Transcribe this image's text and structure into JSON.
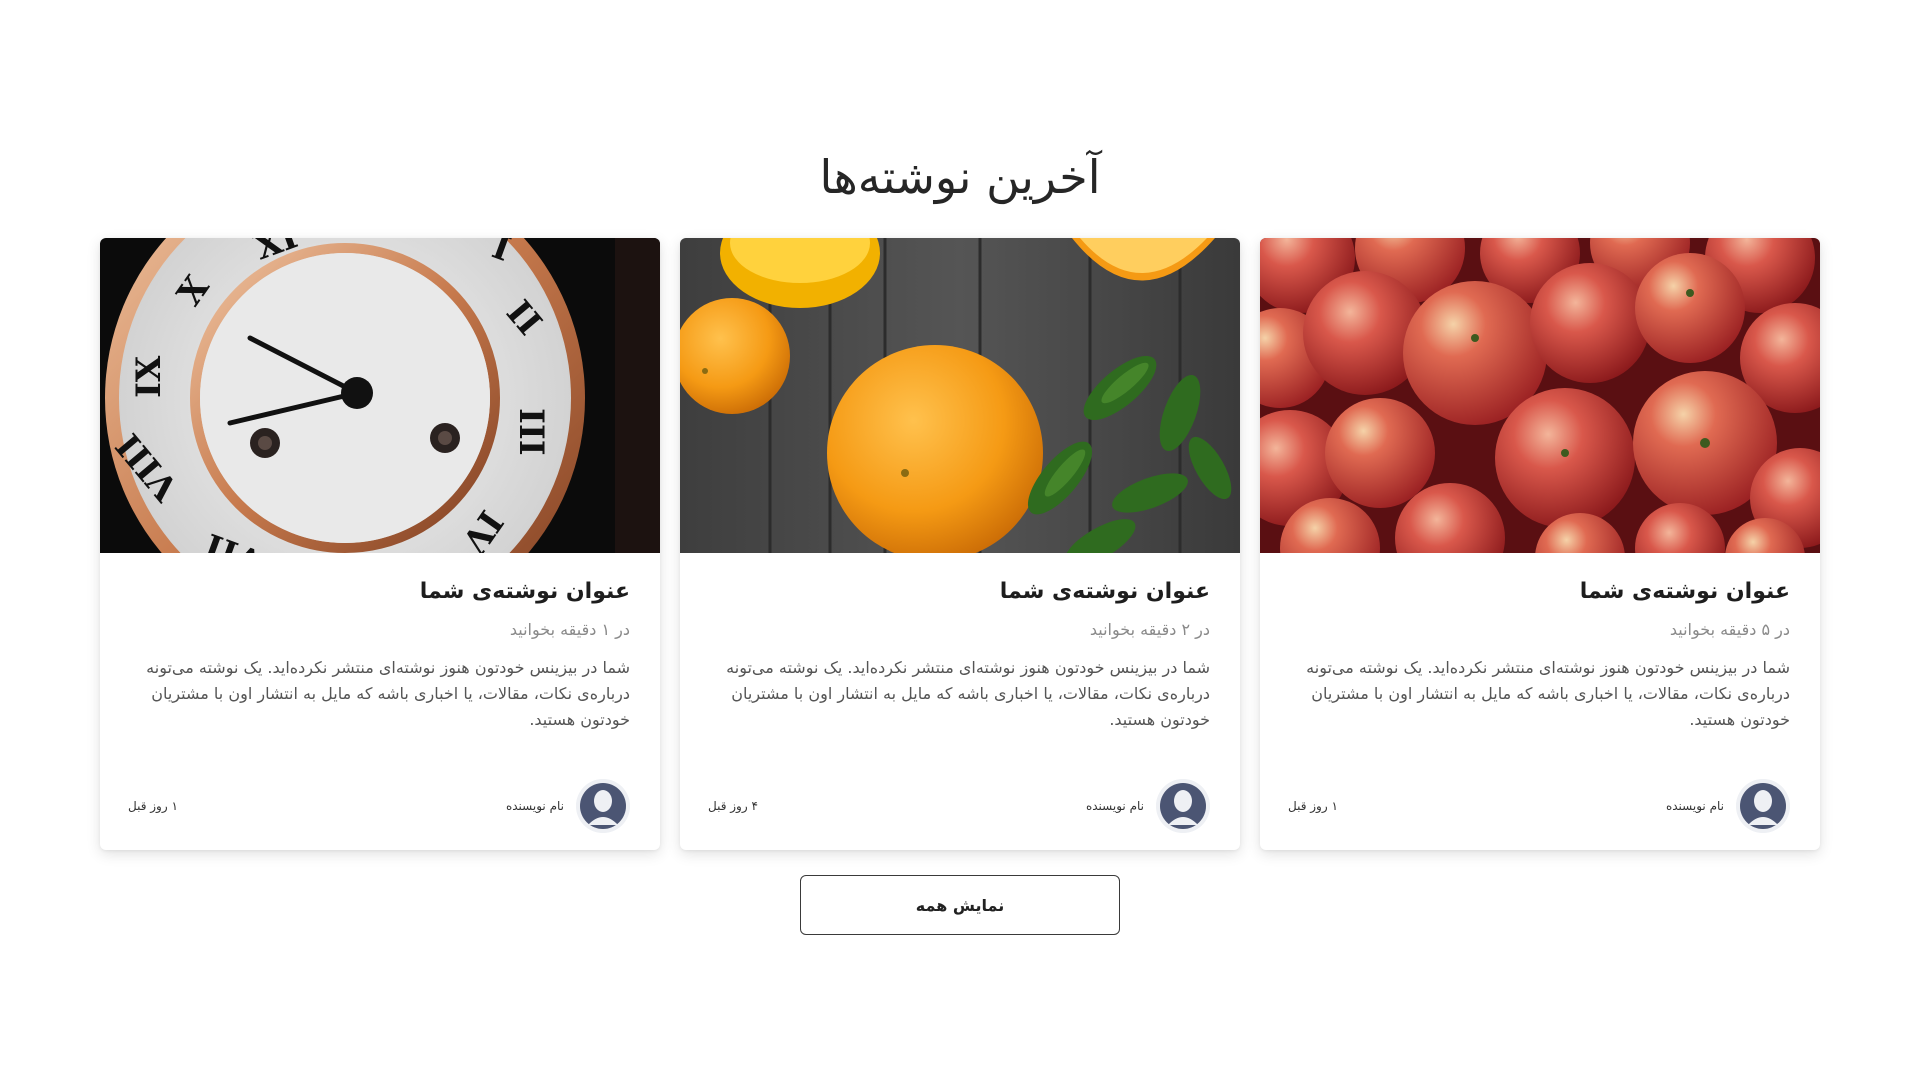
{
  "section": {
    "title": "آخرین نوشته‌ها"
  },
  "posts": [
    {
      "image_icon": "apples-photo",
      "title": "عنوان نوشته‌ی شما",
      "read_time": "در ۵ دقیقه بخوانید",
      "excerpt": "شما در بیزینس خودتون هنوز نوشته‌ای منتشر نکرده‌اید. یک نوشته می‌تونه درباره‌ی نکات، مقالات، یا اخباری باشه که مایل به انتشار اون با مشتریان خودتون هستید.",
      "author_name": "نام نویسنده",
      "avatar_icon": "user-avatar-icon",
      "date": "۱ روز قبل"
    },
    {
      "image_icon": "oranges-photo",
      "title": "عنوان نوشته‌ی شما",
      "read_time": "در ۲ دقیقه بخوانید",
      "excerpt": "شما در بیزینس خودتون هنوز نوشته‌ای منتشر نکرده‌اید. یک نوشته می‌تونه درباره‌ی نکات، مقالات، یا اخباری باشه که مایل به انتشار اون با مشتریان خودتون هستید.",
      "author_name": "نام نویسنده",
      "avatar_icon": "user-avatar-icon",
      "date": "۴ روز قبل"
    },
    {
      "image_icon": "clock-photo",
      "title": "عنوان نوشته‌ی شما",
      "read_time": "در ۱ دقیقه بخوانید",
      "excerpt": "شما در بیزینس خودتون هنوز نوشته‌ای منتشر نکرده‌اید. یک نوشته می‌تونه درباره‌ی نکات، مقالات، یا اخباری باشه که مایل به انتشار اون با مشتریان خودتون هستید.",
      "author_name": "نام نویسنده",
      "avatar_icon": "user-avatar-icon",
      "date": "۱ روز قبل"
    }
  ],
  "show_all": {
    "label": "نمایش همه"
  },
  "colors": {
    "card_background": "#ffffff",
    "title_text": "#1e1e1e",
    "muted_text": "#8a8a8a",
    "avatar_figure": "#4b5573",
    "button_border": "#3a3a3a"
  }
}
